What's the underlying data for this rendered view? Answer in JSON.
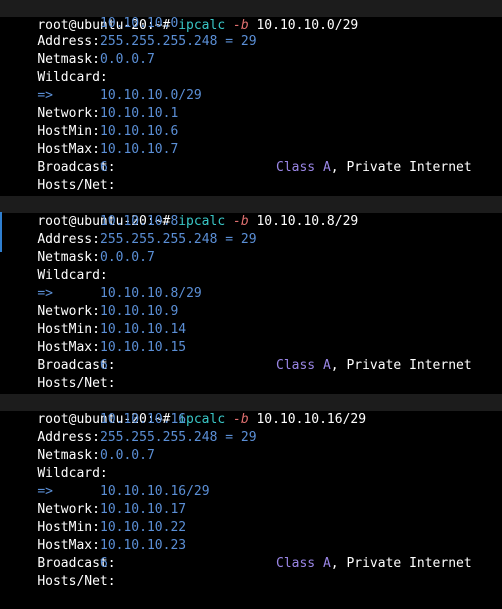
{
  "colors": {
    "background": "#000000",
    "label": "#ffffff",
    "value": "#5b8fd6",
    "command": "#39c6c6",
    "flag": "#e07070",
    "class": "#9a86e6",
    "highlight_bar": "#1c1c1c",
    "edge_marker": "#2f7fd0"
  },
  "blocks": [
    {
      "prompt": "root@ubuntu-20:~#",
      "command": "ipcalc",
      "flag": "-b",
      "argument": "10.10.10.0/29",
      "labels": {
        "address": "Address:",
        "netmask": "Netmask:",
        "wildcard": "Wildcard:",
        "arrow": "=>",
        "network": "Network:",
        "hostmin": "HostMin:",
        "hostmax": "HostMax:",
        "broadcast": "Broadcast:",
        "hostsnet": "Hosts/Net:"
      },
      "address": "10.10.10.0",
      "netmask": "255.255.255.248 = 29",
      "wildcard": "0.0.0.7",
      "network": "10.10.10.0/29",
      "hostmin": "10.10.10.1",
      "hostmax": "10.10.10.6",
      "broadcast": "10.10.10.7",
      "hosts": "6",
      "class_label": "Class A",
      "class_rest": ", Private Internet"
    },
    {
      "prompt": "root@ubuntu-20:~#",
      "command": "ipcalc",
      "flag": "-b",
      "argument": "10.10.10.8/29",
      "labels": {
        "address": "Address:",
        "netmask": "Netmask:",
        "wildcard": "Wildcard:",
        "arrow": "=>",
        "network": "Network:",
        "hostmin": "HostMin:",
        "hostmax": "HostMax:",
        "broadcast": "Broadcast:",
        "hostsnet": "Hosts/Net:"
      },
      "address": "10.10.10.8",
      "netmask": "255.255.255.248 = 29",
      "wildcard": "0.0.0.7",
      "network": "10.10.10.8/29",
      "hostmin": "10.10.10.9",
      "hostmax": "10.10.10.14",
      "broadcast": "10.10.10.15",
      "hosts": "6",
      "class_label": "Class A",
      "class_rest": ", Private Internet"
    },
    {
      "prompt": "root@ubuntu-20:~#",
      "command": "ipcalc",
      "flag": "-b",
      "argument": "10.10.10.16/29",
      "labels": {
        "address": "Address:",
        "netmask": "Netmask:",
        "wildcard": "Wildcard:",
        "arrow": "=>",
        "network": "Network:",
        "hostmin": "HostMin:",
        "hostmax": "HostMax:",
        "broadcast": "Broadcast:",
        "hostsnet": "Hosts/Net:"
      },
      "address": "10.10.10.16",
      "netmask": "255.255.255.248 = 29",
      "wildcard": "0.0.0.7",
      "network": "10.10.10.16/29",
      "hostmin": "10.10.10.17",
      "hostmax": "10.10.10.22",
      "broadcast": "10.10.10.23",
      "hosts": "6",
      "class_label": "Class A",
      "class_rest": ", Private Internet"
    }
  ]
}
